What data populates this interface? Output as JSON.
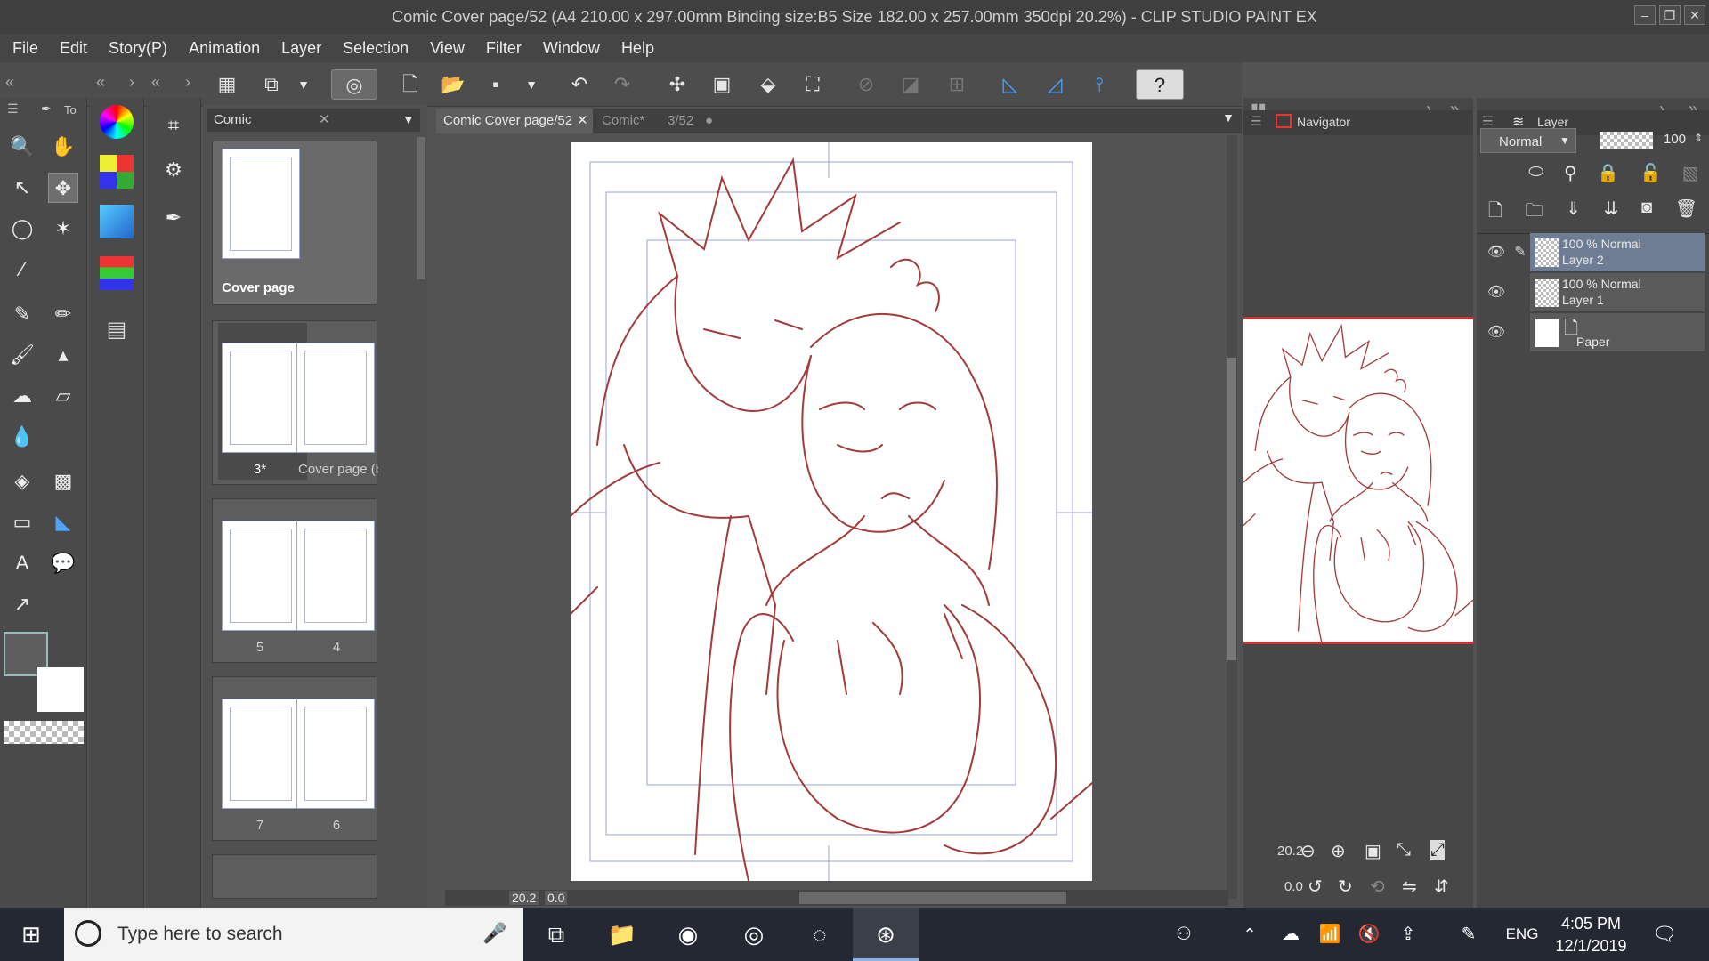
{
  "window": {
    "title": "Comic Cover page/52 (A4 210.00 x 297.00mm Binding size:B5 Size 182.00 x 257.00mm 350dpi 20.2%) - CLIP STUDIO PAINT EX"
  },
  "menu": [
    "File",
    "Edit",
    "Story(P)",
    "Animation",
    "Layer",
    "Selection",
    "View",
    "Filter",
    "Window",
    "Help"
  ],
  "toolpanel": {
    "tab_label": "To"
  },
  "pagepanel": {
    "title": "Comic",
    "pages": [
      {
        "label": "Cover page",
        "thumbs": 1
      },
      {
        "label": "3*",
        "label2": "Cover page (back"
      },
      {
        "label": "5",
        "label2": "4"
      },
      {
        "label": "7",
        "label2": "6"
      }
    ]
  },
  "tabs": [
    {
      "label": "Comic Cover page/52"
    },
    {
      "label": "Comic*"
    },
    {
      "label": "3/52"
    }
  ],
  "canvas": {
    "zoom": "20.2",
    "rotation": "0.0",
    "line_color": "#a33a3a"
  },
  "navigator": {
    "title": "Navigator",
    "zoom": "20.2",
    "rotation": "0.0"
  },
  "layers": {
    "title": "Layer",
    "blend_mode": "Normal",
    "opacity": "100",
    "items": [
      {
        "line1": "100 % Normal",
        "line2": "Layer 2",
        "selected": true
      },
      {
        "line1": "100 % Normal",
        "line2": "Layer 1",
        "selected": false
      },
      {
        "line1": "",
        "line2": "Paper",
        "selected": false
      }
    ]
  },
  "taskbar": {
    "search_placeholder": "Type here to search",
    "lang": "ENG",
    "time": "4:05 PM",
    "date": "12/1/2019"
  }
}
